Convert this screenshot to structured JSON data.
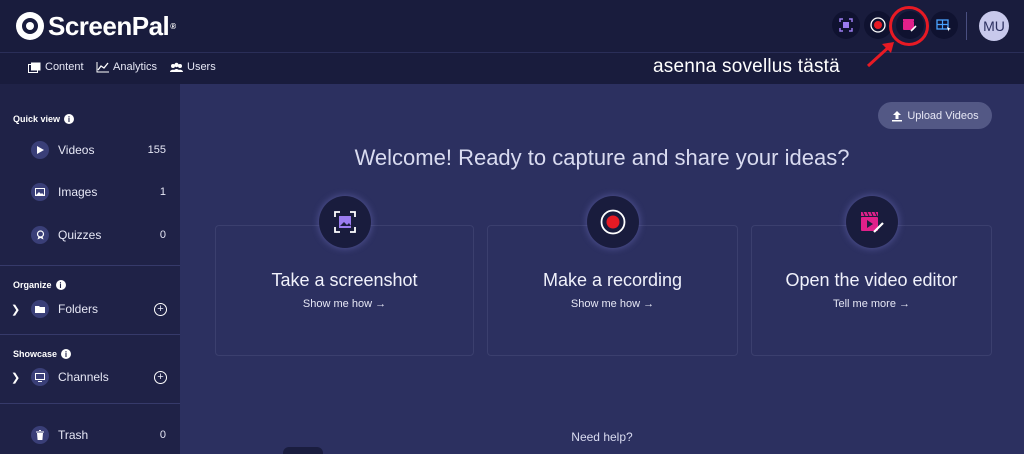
{
  "app": {
    "name": "ScreenPal",
    "registered": "®"
  },
  "header": {
    "tools": [
      {
        "icon": "screenshot-icon"
      },
      {
        "icon": "record-icon"
      },
      {
        "icon": "video-editor-icon"
      },
      {
        "icon": "screen-grid-icon"
      }
    ],
    "avatar_initials": "MU",
    "highlight_color": "#e81a24"
  },
  "subnav": {
    "items": [
      {
        "label": "Content",
        "icon": "content-icon"
      },
      {
        "label": "Analytics",
        "icon": "analytics-icon"
      },
      {
        "label": "Users",
        "icon": "users-icon"
      }
    ]
  },
  "annotation": {
    "text": "asenna sovellus tästä"
  },
  "sidebar": {
    "quick_view": {
      "title": "Quick view",
      "info": "i"
    },
    "items": [
      {
        "label": "Videos",
        "count": "155",
        "icon": "play-icon"
      },
      {
        "label": "Images",
        "count": "1",
        "icon": "image-icon"
      },
      {
        "label": "Quizzes",
        "count": "0",
        "icon": "quiz-icon"
      }
    ],
    "organize": {
      "title": "Organize",
      "info": "i",
      "item": {
        "label": "Folders",
        "icon": "folder-icon"
      }
    },
    "showcase": {
      "title": "Showcase",
      "info": "i",
      "item": {
        "label": "Channels",
        "icon": "channel-icon"
      }
    },
    "trash": {
      "label": "Trash",
      "count": "0",
      "icon": "trash-icon"
    }
  },
  "main": {
    "upload_label": "Upload Videos",
    "welcome": "Welcome! Ready to capture and share your ideas?",
    "cards": [
      {
        "title": "Take a screenshot",
        "link": "Show me how →",
        "icon": "screenshot-icon"
      },
      {
        "title": "Make a recording",
        "link": "Show me how →",
        "icon": "record-icon"
      },
      {
        "title": "Open the video editor",
        "link": "Tell me more →",
        "icon": "video-editor-icon"
      }
    ],
    "help": "Need help?"
  },
  "colors": {
    "background": "#2c3060",
    "topbar": "#191c3d",
    "sidebar": "#1f2247",
    "accent": "#e0208a",
    "record": "#e81a24"
  }
}
